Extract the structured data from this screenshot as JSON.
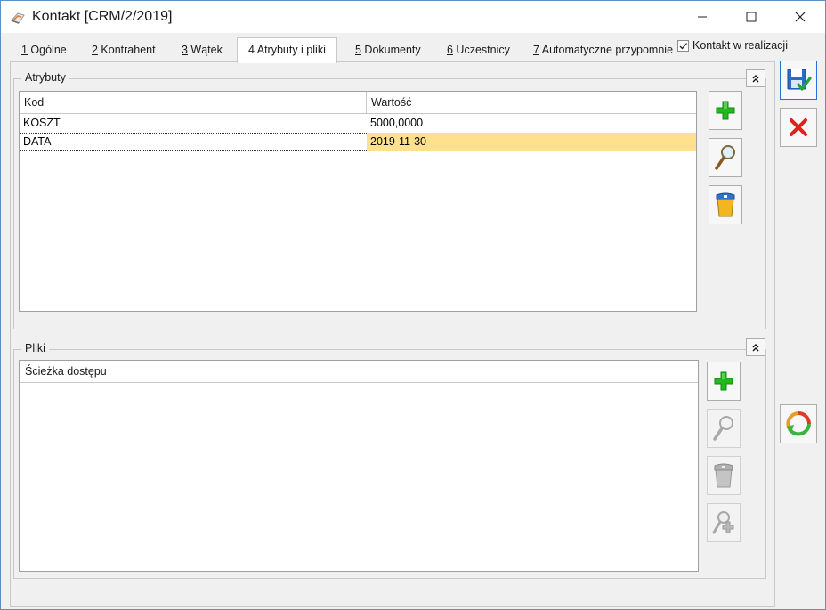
{
  "window": {
    "title": "Kontakt [CRM/2/2019]",
    "minimize_icon": "minimize-icon",
    "maximize_icon": "maximize-icon",
    "close_icon": "close-icon"
  },
  "tabs": [
    {
      "num": "1",
      "label": " Ogólne"
    },
    {
      "num": "2",
      "label": " Kontrahent"
    },
    {
      "num": "3",
      "label": " Wątek"
    },
    {
      "num": "4",
      "label": " Atrybuty i pliki"
    },
    {
      "num": "5",
      "label": " Dokumenty"
    },
    {
      "num": "6",
      "label": " Uczestnicy"
    },
    {
      "num": "7",
      "label": " Automatyczne przypomnie"
    }
  ],
  "active_tab": "4 Atrybuty i pliki",
  "realization": {
    "label": "Kontakt w realizacji",
    "checked": true
  },
  "attributes": {
    "title": "Atrybuty",
    "columns": [
      "Kod",
      "Wartość"
    ],
    "rows": [
      {
        "code": "KOSZT",
        "value": "5000,0000"
      },
      {
        "code": "DATA",
        "value": "2019-11-30"
      }
    ],
    "selected_row": "DATA",
    "buttons": [
      "add-icon",
      "edit-icon",
      "delete-icon"
    ]
  },
  "files": {
    "title": "Pliki",
    "columns": [
      "Ścieżka dostępu"
    ],
    "rows": [],
    "buttons": [
      "add-icon",
      "edit-icon",
      "delete-icon",
      "add-link-icon"
    ]
  },
  "actions": [
    "save-icon",
    "cancel-icon",
    "refresh-icon"
  ],
  "colors": {
    "selected_cell": "#ffe08c",
    "add_green": "#22b81e",
    "cancel_red": "#e02020",
    "save_blue": "#2a6cc8"
  }
}
